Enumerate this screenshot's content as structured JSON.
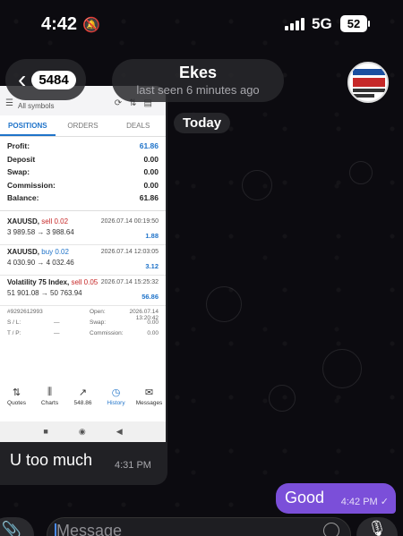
{
  "status_bar": {
    "time": "4:42",
    "network": "5G",
    "battery": "52"
  },
  "header": {
    "back_count": "5484",
    "chat_name": "Ekes",
    "last_seen": "last seen 6 minutes ago"
  },
  "date_separator": "Today",
  "incoming": {
    "screenshot": {
      "symbols_label": "All symbols",
      "tabs": [
        "POSITIONS",
        "ORDERS",
        "DEALS"
      ],
      "summary": [
        {
          "label": "Profit:",
          "value": "61.86"
        },
        {
          "label": "Deposit",
          "value": "0.00"
        },
        {
          "label": "Swap:",
          "value": "0.00"
        },
        {
          "label": "Commission:",
          "value": "0.00"
        },
        {
          "label": "Balance:",
          "value": "61.86"
        }
      ],
      "trades": [
        {
          "symbol": "XAUUSD,",
          "dir": "sell 0.02",
          "time": "2026.07.14 00:19:50",
          "prices": "3 989.58 → 3 988.64",
          "pl": "1.88"
        },
        {
          "symbol": "XAUUSD,",
          "dir": "buy 0.02",
          "time": "2026.07.14 12:03:05",
          "prices": "4 030.90 → 4 032.46",
          "pl": "3.12"
        },
        {
          "symbol": "Volatility 75 Index,",
          "dir": "sell 0.05",
          "time": "2026.07.14 15:25:32",
          "prices": "51 901.08 → 50 763.94",
          "pl": "56.86"
        }
      ],
      "detail": {
        "ticket": "#9292612993",
        "open_label": "Open:",
        "open_value": "2026.07.14 13:20:42",
        "sl_label": "S / L:",
        "sl_value": "—",
        "swap_label": "Swap:",
        "swap_value": "0.00",
        "tp_label": "T / P:",
        "tp_value": "—",
        "comm_label": "Commission:",
        "comm_value": "0.00"
      },
      "nav": [
        "Quotes",
        "Charts",
        "548.86",
        "History",
        "Messages"
      ]
    },
    "caption": "U too much",
    "time": "4:31 PM"
  },
  "outgoing": {
    "text": "Good",
    "time": "4:42 PM",
    "status": "✓"
  },
  "composer": {
    "placeholder": "Message"
  },
  "colors": {
    "outgoing_bubble": "#7b4fd9",
    "background": "#0c0b10",
    "accent_blue": "#1f73c9"
  }
}
